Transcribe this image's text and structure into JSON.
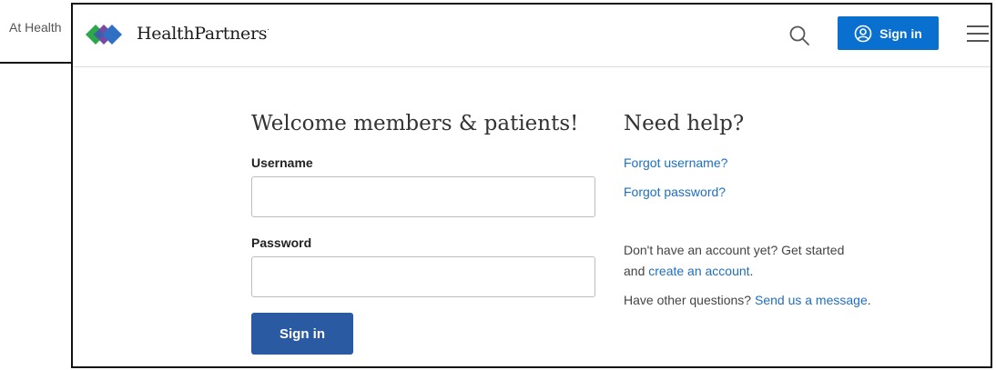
{
  "background": {
    "text": "At Health"
  },
  "header": {
    "brand": "HealthPartners",
    "brand_mark": "·",
    "signin_label": "Sign in"
  },
  "login": {
    "title": "Welcome members & patients!",
    "username_label": "Username",
    "username_value": "",
    "password_label": "Password",
    "password_value": "",
    "submit_label": "Sign in"
  },
  "help": {
    "title": "Need help?",
    "forgot_username": "Forgot username?",
    "forgot_password": "Forgot password?",
    "no_account_line1": "Don't have an account yet? Get started",
    "no_account_prefix": "and ",
    "create_account_link": "create an account",
    "no_account_suffix": ".",
    "other_questions_prefix": "Have other questions? ",
    "send_message_link": "Send us a message",
    "other_questions_suffix": "."
  },
  "colors": {
    "accent": "#0a70d0",
    "signin_button": "#2a5aa1",
    "link": "#1f6fbf",
    "logo_green": "#2aa84a",
    "logo_blue": "#2f6fc4",
    "logo_purple": "#7a4aa3"
  },
  "icons": [
    "search-icon",
    "user-circle-icon",
    "menu-icon",
    "logo-icon"
  ]
}
